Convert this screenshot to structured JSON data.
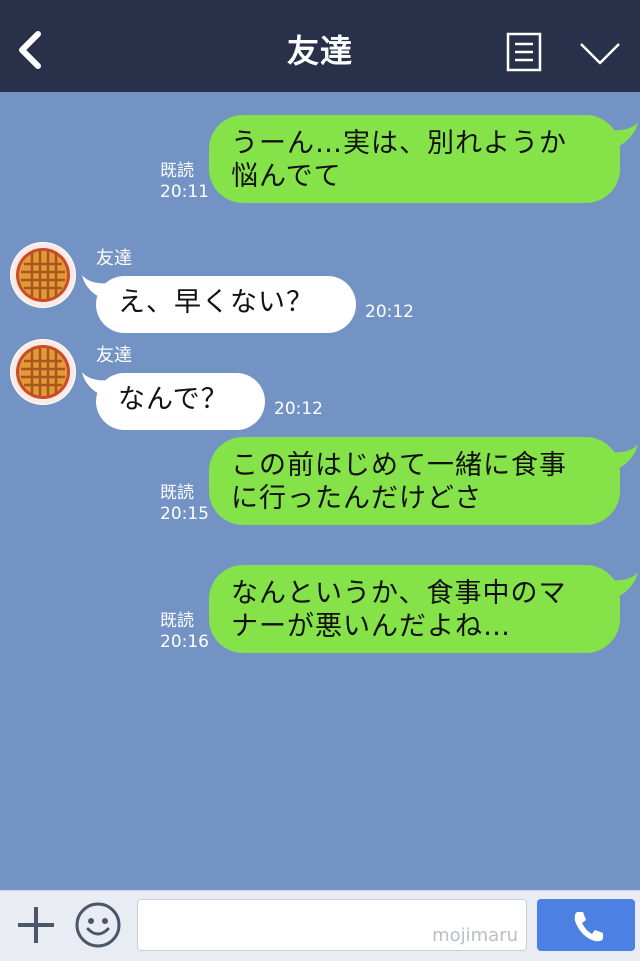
{
  "header": {
    "title": "友達",
    "back_icon": "chevron-left-icon",
    "notes_icon": "notes-icon",
    "menu_icon": "chevron-down-icon"
  },
  "colors": {
    "header_bg": "#283149",
    "chat_bg": "#7293c4",
    "my_bubble": "#85e249",
    "friend_bubble": "#ffffff",
    "call_button": "#4d80e3"
  },
  "messages": [
    {
      "sender": "me",
      "lines": [
        "うーん…実は、別れようか",
        "悩んでて"
      ],
      "read": "既読",
      "time": "20:11"
    },
    {
      "sender": "friend",
      "name": "友達",
      "lines": [
        "え、早くない？"
      ],
      "time": "20:12"
    },
    {
      "sender": "friend",
      "name": "友達",
      "lines": [
        "なんで？"
      ],
      "time": "20:12"
    },
    {
      "sender": "me",
      "lines": [
        "この前はじめて一緒に食事",
        "に行ったんだけどさ"
      ],
      "read": "既読",
      "time": "20:15"
    },
    {
      "sender": "me",
      "lines": [
        "なんというか、食事中のマ",
        "ナーが悪いんだよね…"
      ],
      "read": "既読",
      "time": "20:16"
    }
  ],
  "bottom": {
    "plus_icon": "plus-icon",
    "emoji_icon": "smiley-icon",
    "input_value": "",
    "watermark": "mojimaru",
    "call_icon": "phone-icon"
  }
}
